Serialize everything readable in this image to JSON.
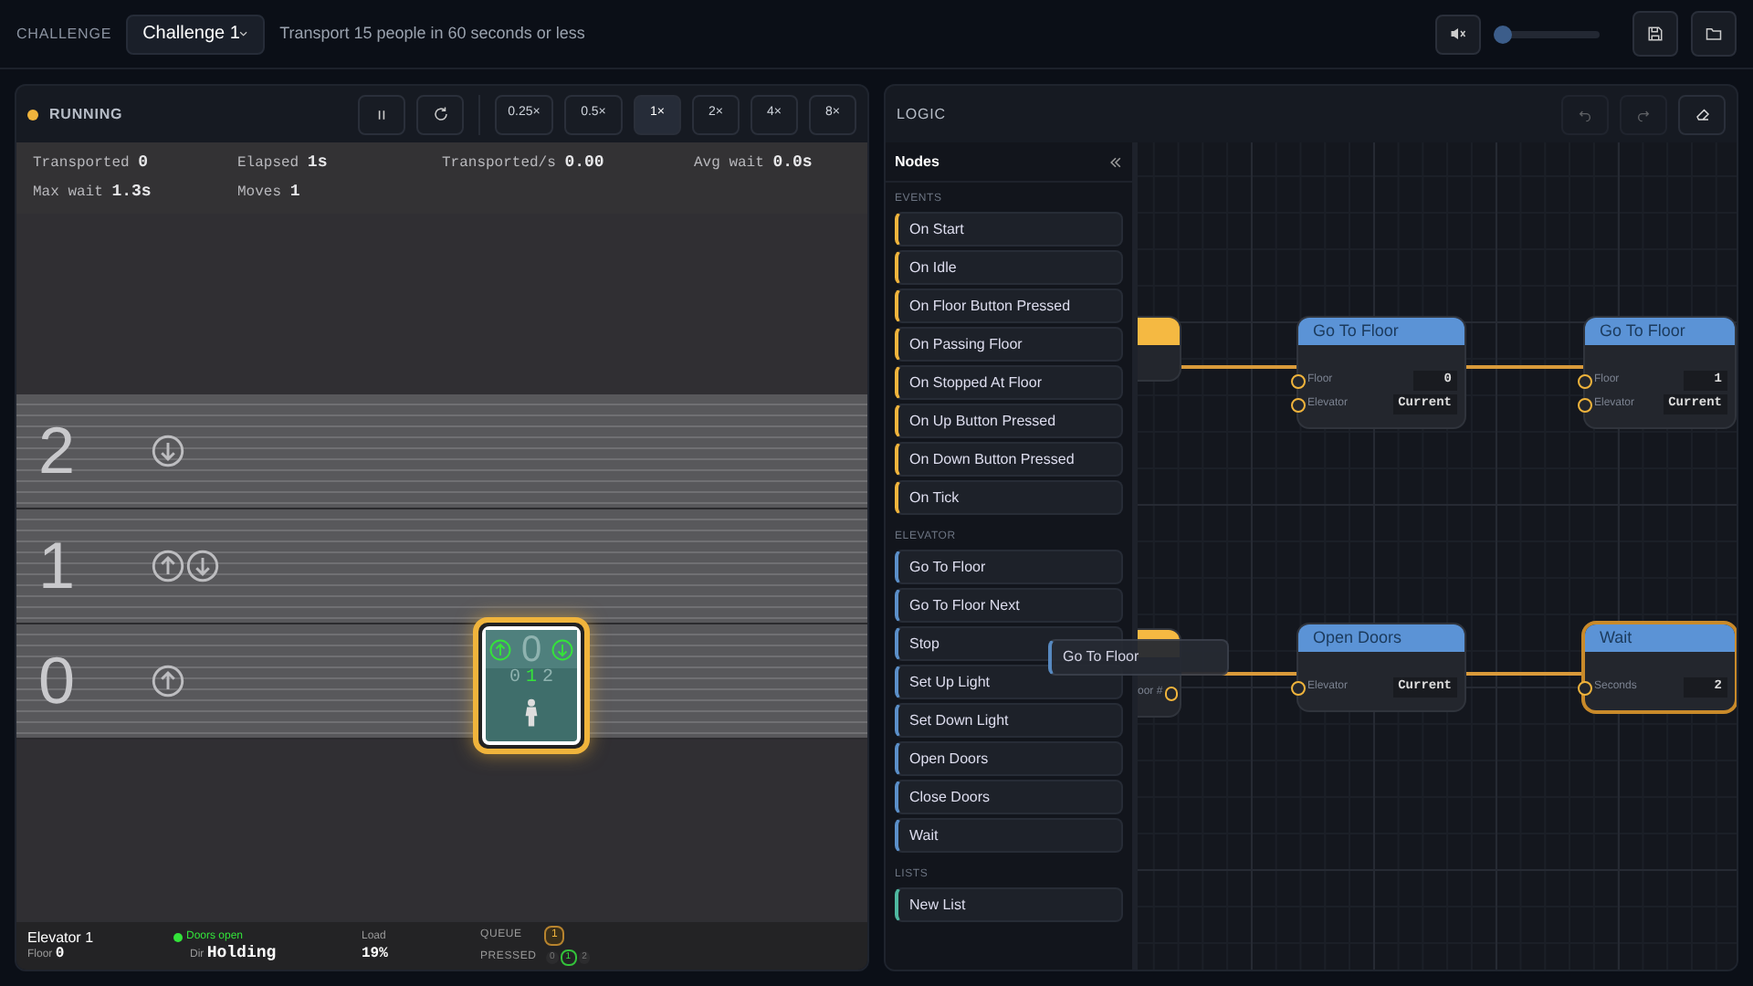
{
  "top_bar": {
    "challenge_label": "CHALLENGE",
    "challenge_select": "Challenge 1",
    "description": "Transport 15 people in 60 seconds or less",
    "volume": {
      "muted": true,
      "level": 0
    }
  },
  "simulation": {
    "status": "RUNNING",
    "running": true,
    "speeds": [
      {
        "label": "0.25×",
        "selected": false
      },
      {
        "label": "0.5×",
        "selected": false
      },
      {
        "label": "1×",
        "selected": true
      },
      {
        "label": "2×",
        "selected": false
      },
      {
        "label": "4×",
        "selected": false
      },
      {
        "label": "8×",
        "selected": false
      }
    ],
    "stats": [
      {
        "label": "Transported",
        "value": "0"
      },
      {
        "label": "Elapsed",
        "value": "1s"
      },
      {
        "label": "Transported/s",
        "value": "0.00"
      },
      {
        "label": "Avg wait",
        "value": "0.0s"
      },
      {
        "label": "Max wait",
        "value": "1.3s"
      },
      {
        "label": "Moves",
        "value": "1"
      }
    ],
    "floors": [
      {
        "number": "2",
        "buttons": [
          {
            "kind": "down"
          }
        ]
      },
      {
        "number": "1",
        "buttons": [
          {
            "kind": "up"
          },
          {
            "kind": "down"
          }
        ]
      },
      {
        "number": "0",
        "buttons": [
          {
            "kind": "up"
          }
        ]
      }
    ],
    "elevator": {
      "floor_display": "0",
      "up_lit": true,
      "down_lit": true,
      "car_buttons": [
        {
          "label": "0",
          "pressed": false
        },
        {
          "label": "1",
          "pressed": true
        },
        {
          "label": "2",
          "pressed": false
        }
      ],
      "passengers": [
        {
          "kind": "person"
        }
      ]
    },
    "footer": {
      "name": "Elevator 1",
      "floor_label": "Floor",
      "floor": "0",
      "doors_open": true,
      "doors": "Doors open",
      "dir_label": "Dir",
      "dir": "Holding",
      "load_label": "Load",
      "load": "19%",
      "queue_label": "QUEUE",
      "queue": [
        "1"
      ],
      "pressed_label": "PRESSED",
      "pressed": [
        {
          "label": "0",
          "selected": false
        },
        {
          "label": "1",
          "selected": true
        },
        {
          "label": "2",
          "selected": false
        }
      ]
    }
  },
  "logic": {
    "title": "LOGIC",
    "palette_title": "Nodes",
    "sections": [
      {
        "title": "EVENTS",
        "kind": "event",
        "items": [
          "On Start",
          "On Idle",
          "On Floor Button Pressed",
          "On Passing Floor",
          "On Stopped At Floor",
          "On Up Button Pressed",
          "On Down Button Pressed",
          "On Tick"
        ]
      },
      {
        "title": "ELEVATOR",
        "kind": "elevator",
        "items": [
          "Go To Floor",
          "Go To Floor Next",
          "Stop",
          "Set Up Light",
          "Set Down Light",
          "Open Doors",
          "Close Doors",
          "Wait"
        ]
      },
      {
        "title": "LISTS",
        "kind": "list",
        "items": [
          "New List"
        ]
      }
    ],
    "canvas_nodes": [
      {
        "kind": "event",
        "selected": false
      },
      {
        "kind": "action",
        "title": "Go To Floor",
        "selected": false,
        "inputs": [
          {
            "label": "Floor",
            "value": "0"
          },
          {
            "label": "Elevator",
            "value": "Current"
          }
        ]
      },
      {
        "kind": "action",
        "title": "Go To Floor",
        "selected": false,
        "inputs": [
          {
            "label": "Floor",
            "value": "1"
          },
          {
            "label": "Elevator",
            "value": "Current"
          }
        ]
      },
      {
        "kind": "event",
        "selected": false,
        "inputs": [
          {
            "label": "oor #"
          }
        ]
      },
      {
        "kind": "action",
        "title": "Open Doors",
        "selected": false,
        "inputs": [
          {
            "label": "Elevator",
            "value": "Current"
          }
        ]
      },
      {
        "kind": "action",
        "title": "Wait",
        "selected": true,
        "inputs": [
          {
            "label": "Seconds",
            "value": "2"
          }
        ]
      }
    ],
    "drag_ghost": "Go To Floor"
  }
}
